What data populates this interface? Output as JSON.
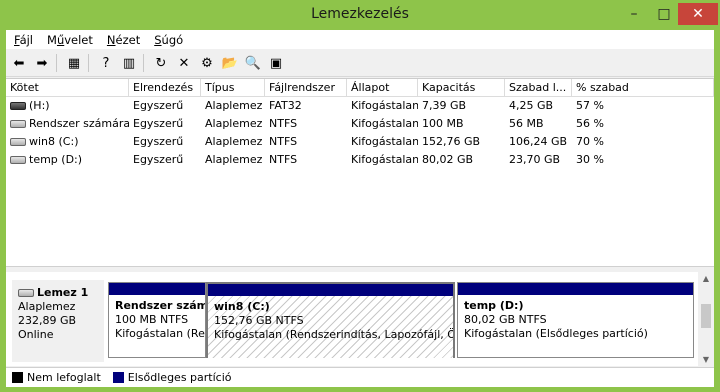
{
  "window": {
    "title": "Lemezkezelés",
    "minimize": "–",
    "maximize": "□",
    "close": "✕"
  },
  "menu": [
    {
      "pre": "",
      "key": "F",
      "post": "ájl"
    },
    {
      "pre": "M",
      "key": "ű",
      "post": "velet"
    },
    {
      "pre": "",
      "key": "N",
      "post": "ézet"
    },
    {
      "pre": "",
      "key": "S",
      "post": "úgó"
    }
  ],
  "toolbar": [
    {
      "name": "back-icon",
      "glyph": "⬅"
    },
    {
      "name": "forward-icon",
      "glyph": "➡"
    },
    {
      "sep": true
    },
    {
      "name": "console-tree-icon",
      "glyph": "▦"
    },
    {
      "sep": true
    },
    {
      "name": "help-icon",
      "glyph": "?"
    },
    {
      "name": "properties-pane-icon",
      "glyph": "▥"
    },
    {
      "sep": true
    },
    {
      "name": "refresh-icon",
      "glyph": "↻"
    },
    {
      "name": "delete-icon",
      "glyph": "✕"
    },
    {
      "name": "properties-icon",
      "glyph": "⚙"
    },
    {
      "name": "open-icon",
      "glyph": "📂"
    },
    {
      "name": "explore-icon",
      "glyph": "🔍"
    },
    {
      "name": "export-icon",
      "glyph": "▣"
    }
  ],
  "table": {
    "columns": [
      "Kötet",
      "Elrendezés",
      "Típus",
      "Fájlrendszer",
      "Állapot",
      "Kapacitás",
      "Szabad l...",
      "% szabad"
    ],
    "rows": [
      {
        "icon": "dark",
        "cells": [
          "(H:)",
          "Egyszerű",
          "Alaplemez",
          "FAT32",
          "Kifogástalan...",
          "7,39 GB",
          "4,25 GB",
          "57 %"
        ]
      },
      {
        "icon": "light",
        "cells": [
          "Rendszer számára ...",
          "Egyszerű",
          "Alaplemez",
          "NTFS",
          "Kifogástalan...",
          "100 MB",
          "56 MB",
          "56 %"
        ]
      },
      {
        "icon": "light",
        "cells": [
          "win8 (C:)",
          "Egyszerű",
          "Alaplemez",
          "NTFS",
          "Kifogástalan...",
          "152,76 GB",
          "106,24 GB",
          "70 %"
        ]
      },
      {
        "icon": "light",
        "cells": [
          "temp (D:)",
          "Egyszerű",
          "Alaplemez",
          "NTFS",
          "Kifogástalan...",
          "80,02 GB",
          "23,70 GB",
          "30 %"
        ]
      }
    ]
  },
  "disk": {
    "name": "Lemez 1",
    "type": "Alaplemez",
    "size": "232,89 GB",
    "status": "Online",
    "partitions": [
      {
        "title": "Rendszer számá",
        "size": "100 MB NTFS",
        "status": "Kifogástalan (Rer"
      },
      {
        "title": "win8  (C:)",
        "size": "152,76 GB NTFS",
        "status": "Kifogástalan (Rendszerindítás, Lapozófájl, Össze"
      },
      {
        "title": "temp  (D:)",
        "size": "80,02 GB NTFS",
        "status": "Kifogástalan (Elsődleges partíció)"
      }
    ]
  },
  "legend": [
    {
      "label": "Nem lefoglalt",
      "color": "#000000"
    },
    {
      "label": "Elsődleges partíció",
      "color": "#00007c"
    }
  ]
}
